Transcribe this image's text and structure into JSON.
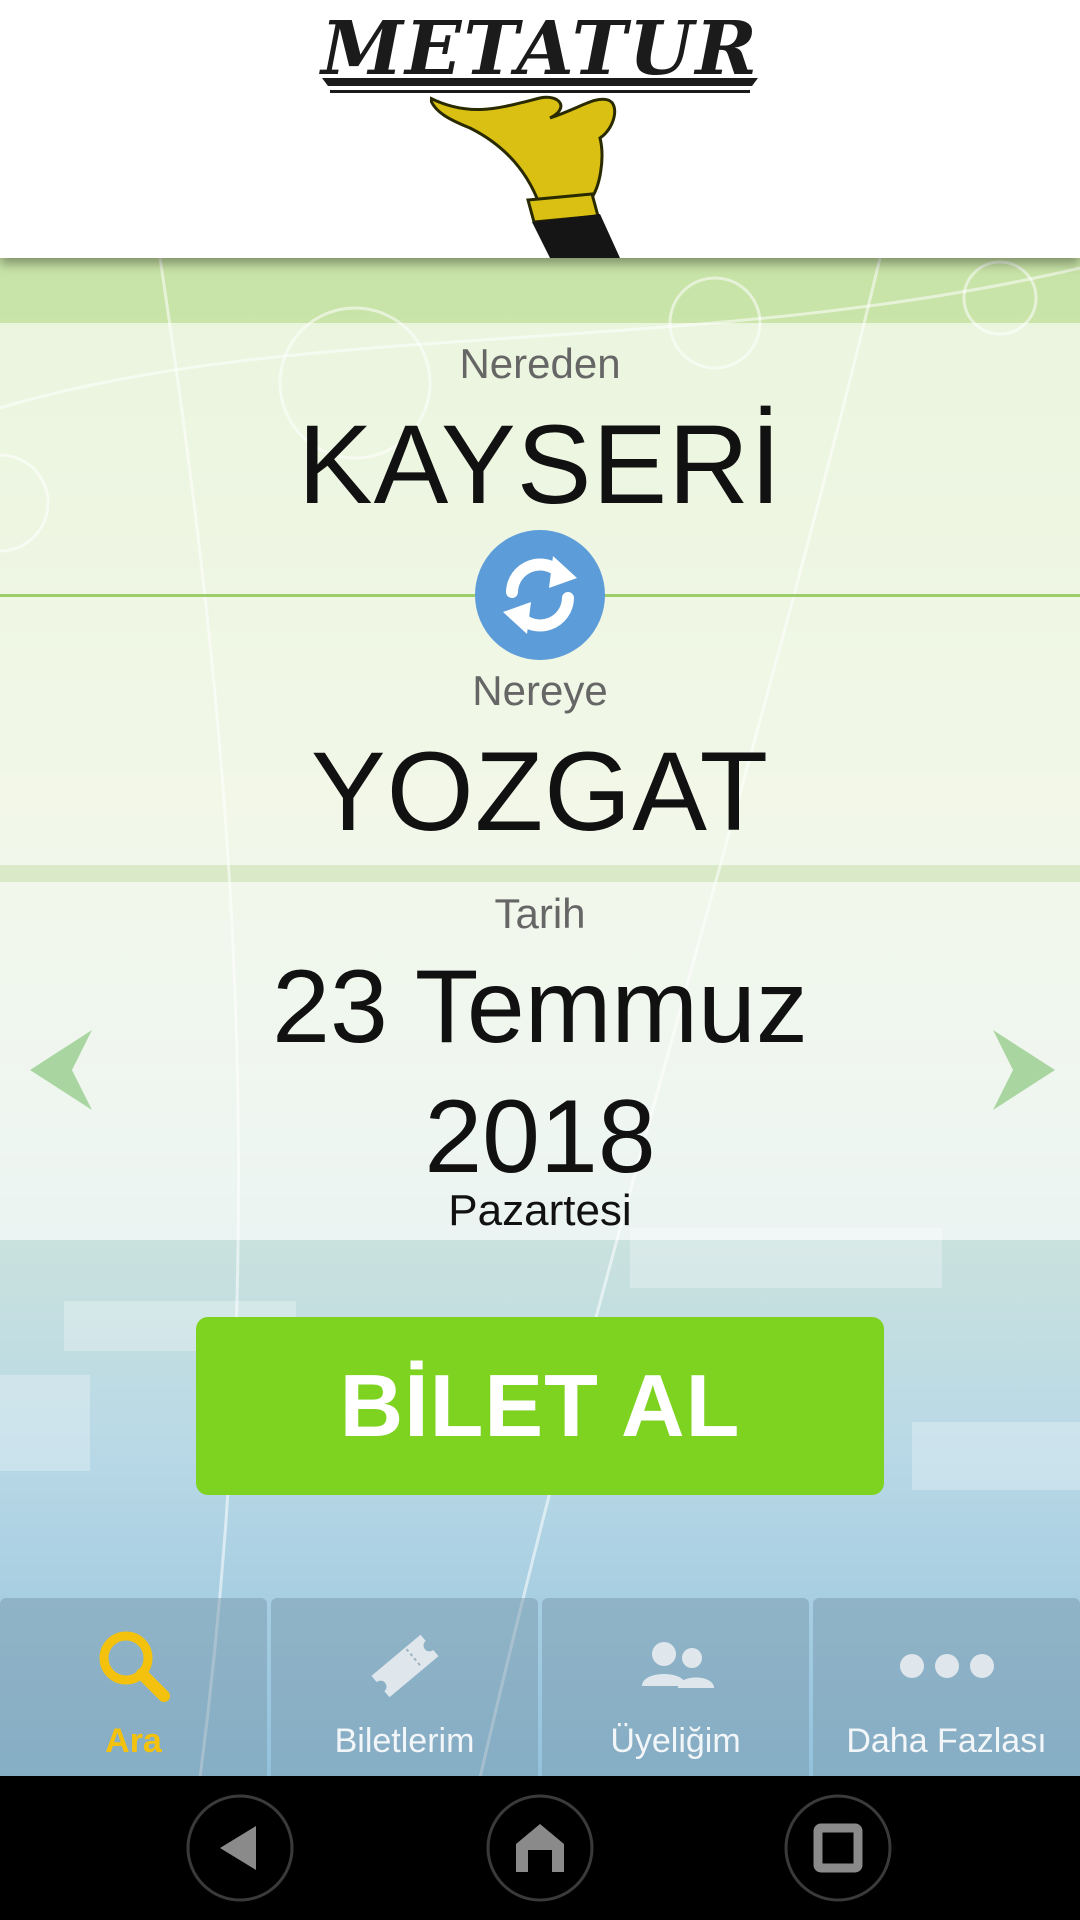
{
  "header": {
    "logo_text": "METATUR"
  },
  "route": {
    "from_label": "Nereden",
    "from_city": "KAYSERİ",
    "to_label": "Nereye",
    "to_city": "YOZGAT"
  },
  "date": {
    "label": "Tarih",
    "day_month": "23 Temmuz",
    "year": "2018",
    "weekday": "Pazartesi"
  },
  "buy_button": {
    "label": "BİLET AL",
    "color": "#7ed321"
  },
  "tabs": [
    {
      "label": "Ara",
      "icon": "search-icon",
      "active": true
    },
    {
      "label": "Biletlerim",
      "icon": "ticket-icon",
      "active": false
    },
    {
      "label": "Üyeliğim",
      "icon": "users-icon",
      "active": false
    },
    {
      "label": "Daha Fazlası",
      "icon": "more-icon",
      "active": false
    }
  ],
  "colors": {
    "accent": "#f4c20d",
    "swap": "#5c9cd8"
  }
}
